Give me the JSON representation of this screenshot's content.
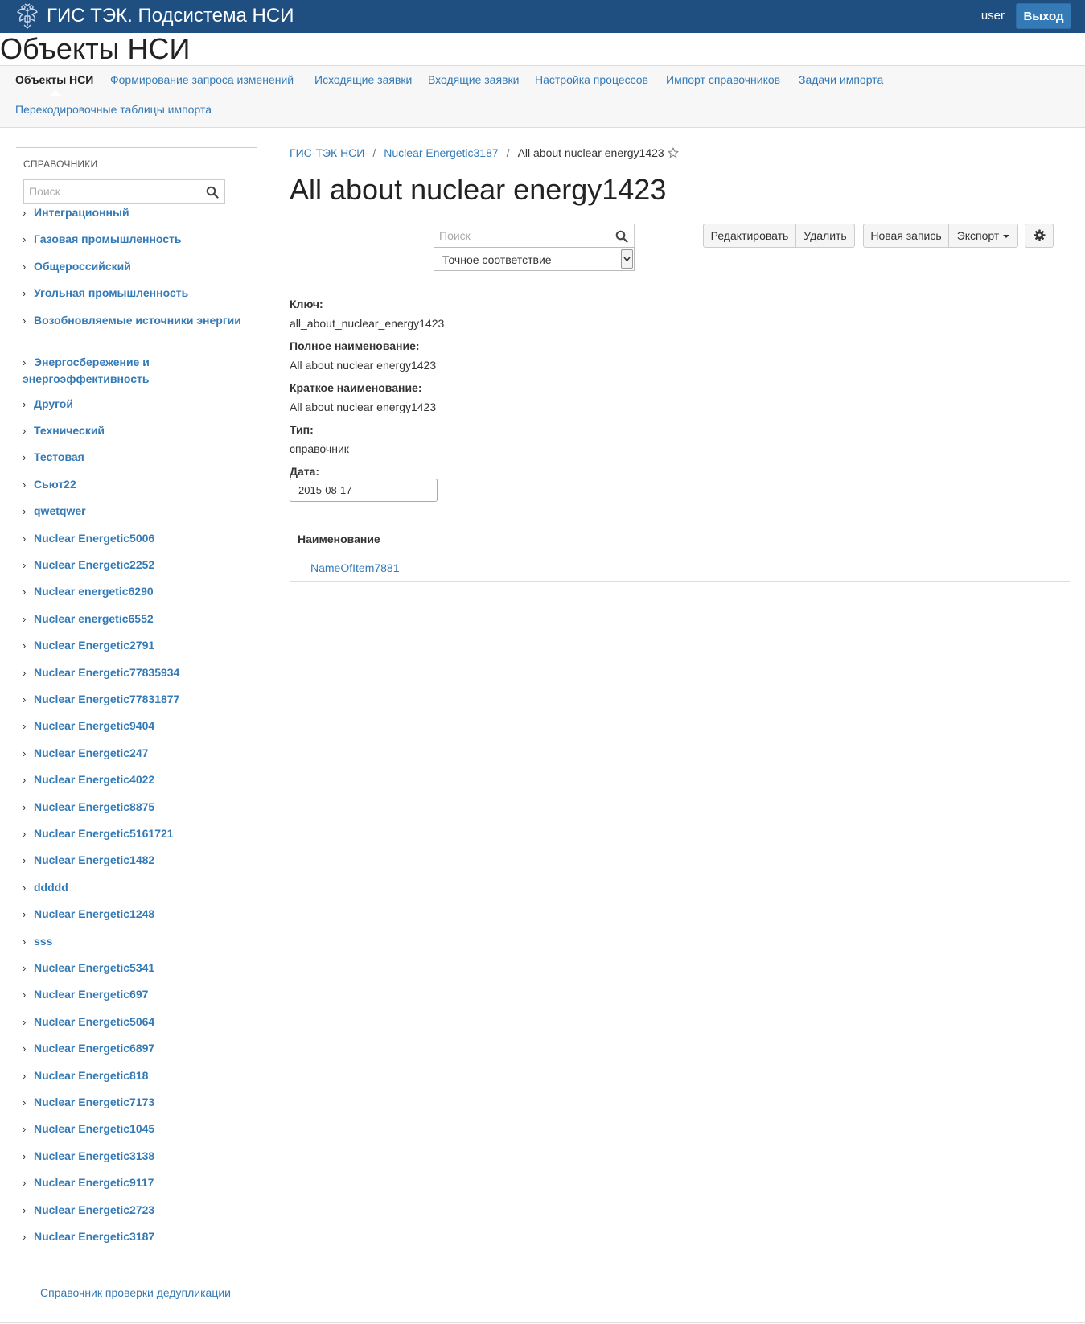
{
  "header": {
    "app_title": "ГИС ТЭК. Подсистема НСИ",
    "user_name": "user",
    "logout_label": "Выход",
    "emblem_icon": "double-headed-eagle-icon",
    "bg_color": "#1f4e80"
  },
  "page_title": "Объекты НСИ",
  "nav": {
    "items": [
      {
        "label": "Объекты НСИ",
        "active": true
      },
      {
        "label": "Формирование запроса изменений"
      },
      {
        "label": "Исходящие заявки"
      },
      {
        "label": "Входящие заявки"
      },
      {
        "label": "Настройка процессов"
      },
      {
        "label": "Импорт справочников"
      },
      {
        "label": "Задачи импорта"
      },
      {
        "label": "Перекодировочные таблицы импорта"
      }
    ]
  },
  "sidebar": {
    "header": "СПРАВОЧНИКИ",
    "search_placeholder": "Поиск",
    "items": [
      {
        "label": "Интеграционный"
      },
      {
        "label": "Газовая промышленность"
      },
      {
        "label": "Общероссийский"
      },
      {
        "label": "Угольная промышленность"
      },
      {
        "label": "Возобновляемые источники энергии"
      },
      {
        "label": "Энергосбережение и энергоэффективность"
      },
      {
        "label": "Другой"
      },
      {
        "label": "Технический"
      },
      {
        "label": "Тестовая"
      },
      {
        "label": "Сьют22"
      },
      {
        "label": "qwetqwer"
      },
      {
        "label": "Nuclear Energetic5006"
      },
      {
        "label": "Nuclear Energetic2252"
      },
      {
        "label": "Nuclear energetic6290"
      },
      {
        "label": "Nuclear energetic6552"
      },
      {
        "label": "Nuclear Energetic2791"
      },
      {
        "label": "Nuclear Energetic77835934"
      },
      {
        "label": "Nuclear Energetic77831877"
      },
      {
        "label": "Nuclear Energetic9404"
      },
      {
        "label": "Nuclear Energetic247"
      },
      {
        "label": "Nuclear Energetic4022"
      },
      {
        "label": "Nuclear Energetic8875"
      },
      {
        "label": "Nuclear Energetic5161721"
      },
      {
        "label": "Nuclear Energetic1482"
      },
      {
        "label": "ddddd"
      },
      {
        "label": "Nuclear Energetic1248"
      },
      {
        "label": "sss"
      },
      {
        "label": "Nuclear Energetic5341"
      },
      {
        "label": "Nuclear Energetic697"
      },
      {
        "label": "Nuclear Energetic5064"
      },
      {
        "label": "Nuclear Energetic6897"
      },
      {
        "label": "Nuclear Energetic818"
      },
      {
        "label": "Nuclear Energetic7173"
      },
      {
        "label": "Nuclear Energetic1045"
      },
      {
        "label": "Nuclear Energetic3138"
      },
      {
        "label": "Nuclear Energetic9117"
      },
      {
        "label": "Nuclear Energetic2723"
      },
      {
        "label": "Nuclear Energetic3187"
      }
    ],
    "leaf_label": "Справочник проверки дедупликации"
  },
  "breadcrumb": {
    "root": "ГИС-ТЭК НСИ",
    "parent": "Nuclear Energetic3187",
    "current": "All about nuclear energy1423"
  },
  "record": {
    "title": "All about nuclear energy1423",
    "search_placeholder": "Поиск",
    "match_mode": "Точное соответствие",
    "buttons": {
      "edit": "Редактировать",
      "delete": "Удалить",
      "new_record": "Новая запись",
      "export": "Экспорт"
    },
    "fields": [
      {
        "label": "Ключ:",
        "value": "all_about_nuclear_energy1423"
      },
      {
        "label": "Полное наименование:",
        "value": "All about nuclear energy1423"
      },
      {
        "label": "Краткое наименование:",
        "value": "All about nuclear energy1423"
      },
      {
        "label": "Тип:",
        "value": "справочник"
      }
    ],
    "date_label": "Дата:",
    "date_value": "2015-08-17",
    "table": {
      "column": "Наименование",
      "rows": [
        "NameOfItem7881"
      ]
    }
  },
  "colors": {
    "link": "#337ab7",
    "accent": "#1f4e80"
  }
}
